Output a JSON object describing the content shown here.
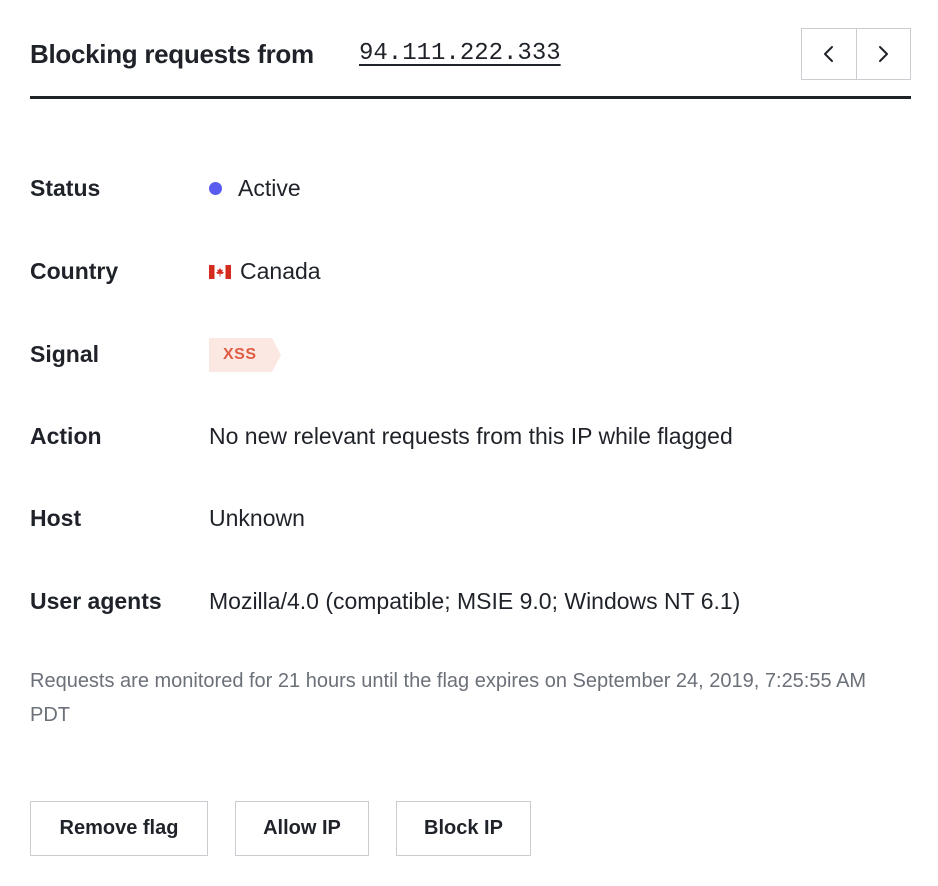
{
  "header": {
    "title": "Blocking requests from",
    "ip": "94.111.222.333",
    "prev_icon": "chevron-left-icon",
    "next_icon": "chevron-right-icon"
  },
  "details": {
    "status": {
      "label": "Status",
      "value": "Active",
      "dot_color": "#5a5cf0"
    },
    "country": {
      "label": "Country",
      "value": "Canada",
      "flag_icon": "canada-flag-icon"
    },
    "signal": {
      "label": "Signal",
      "value": "XSS",
      "tag_bg": "#fbe8e3",
      "tag_color": "#e05c45"
    },
    "action": {
      "label": "Action",
      "value": "No new relevant requests from this IP while flagged"
    },
    "host": {
      "label": "Host",
      "value": "Unknown"
    },
    "user_agents": {
      "label": "User agents",
      "value": "Mozilla/4.0 (compatible; MSIE 9.0; Windows NT 6.1)"
    }
  },
  "note": "Requests are monitored for 21 hours until the flag expires on September 24, 2019, 7:25:55 AM PDT",
  "actions": {
    "remove_flag": "Remove flag",
    "allow_ip": "Allow IP",
    "block_ip": "Block IP"
  }
}
